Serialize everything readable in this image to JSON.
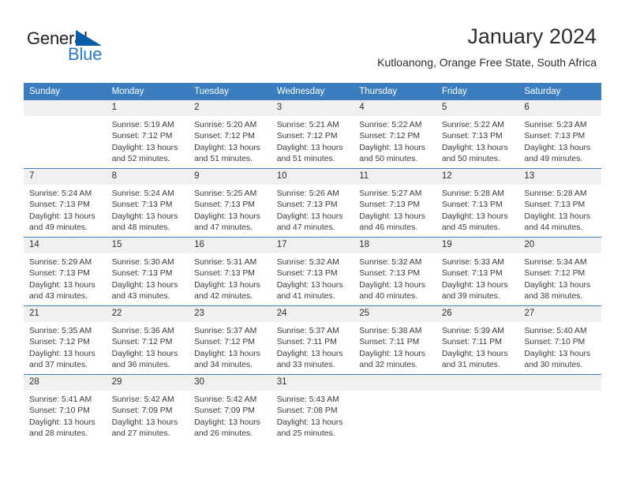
{
  "brand": {
    "name_part1": "General",
    "name_part2": "Blue",
    "accent_color": "#2b7cc4",
    "triangle_color": "#0a5ca8"
  },
  "header": {
    "title": "January 2024",
    "subtitle": "Kutloanong, Orange Free State, South Africa"
  },
  "calendar": {
    "header_bg": "#3b7dbf",
    "daynum_bg": "#f0f0f0",
    "weekday_headers": [
      "Sunday",
      "Monday",
      "Tuesday",
      "Wednesday",
      "Thursday",
      "Friday",
      "Saturday"
    ],
    "weeks": [
      [
        {
          "day": "",
          "blank": true,
          "sunrise": "",
          "sunset": "",
          "daylight_line1": "",
          "daylight_line2": ""
        },
        {
          "day": "1",
          "sunrise": "Sunrise: 5:19 AM",
          "sunset": "Sunset: 7:12 PM",
          "daylight_line1": "Daylight: 13 hours",
          "daylight_line2": "and 52 minutes."
        },
        {
          "day": "2",
          "sunrise": "Sunrise: 5:20 AM",
          "sunset": "Sunset: 7:12 PM",
          "daylight_line1": "Daylight: 13 hours",
          "daylight_line2": "and 51 minutes."
        },
        {
          "day": "3",
          "sunrise": "Sunrise: 5:21 AM",
          "sunset": "Sunset: 7:12 PM",
          "daylight_line1": "Daylight: 13 hours",
          "daylight_line2": "and 51 minutes."
        },
        {
          "day": "4",
          "sunrise": "Sunrise: 5:22 AM",
          "sunset": "Sunset: 7:12 PM",
          "daylight_line1": "Daylight: 13 hours",
          "daylight_line2": "and 50 minutes."
        },
        {
          "day": "5",
          "sunrise": "Sunrise: 5:22 AM",
          "sunset": "Sunset: 7:13 PM",
          "daylight_line1": "Daylight: 13 hours",
          "daylight_line2": "and 50 minutes."
        },
        {
          "day": "6",
          "sunrise": "Sunrise: 5:23 AM",
          "sunset": "Sunset: 7:13 PM",
          "daylight_line1": "Daylight: 13 hours",
          "daylight_line2": "and 49 minutes."
        }
      ],
      [
        {
          "day": "7",
          "sunrise": "Sunrise: 5:24 AM",
          "sunset": "Sunset: 7:13 PM",
          "daylight_line1": "Daylight: 13 hours",
          "daylight_line2": "and 49 minutes."
        },
        {
          "day": "8",
          "sunrise": "Sunrise: 5:24 AM",
          "sunset": "Sunset: 7:13 PM",
          "daylight_line1": "Daylight: 13 hours",
          "daylight_line2": "and 48 minutes."
        },
        {
          "day": "9",
          "sunrise": "Sunrise: 5:25 AM",
          "sunset": "Sunset: 7:13 PM",
          "daylight_line1": "Daylight: 13 hours",
          "daylight_line2": "and 47 minutes."
        },
        {
          "day": "10",
          "sunrise": "Sunrise: 5:26 AM",
          "sunset": "Sunset: 7:13 PM",
          "daylight_line1": "Daylight: 13 hours",
          "daylight_line2": "and 47 minutes."
        },
        {
          "day": "11",
          "sunrise": "Sunrise: 5:27 AM",
          "sunset": "Sunset: 7:13 PM",
          "daylight_line1": "Daylight: 13 hours",
          "daylight_line2": "and 46 minutes."
        },
        {
          "day": "12",
          "sunrise": "Sunrise: 5:28 AM",
          "sunset": "Sunset: 7:13 PM",
          "daylight_line1": "Daylight: 13 hours",
          "daylight_line2": "and 45 minutes."
        },
        {
          "day": "13",
          "sunrise": "Sunrise: 5:28 AM",
          "sunset": "Sunset: 7:13 PM",
          "daylight_line1": "Daylight: 13 hours",
          "daylight_line2": "and 44 minutes."
        }
      ],
      [
        {
          "day": "14",
          "sunrise": "Sunrise: 5:29 AM",
          "sunset": "Sunset: 7:13 PM",
          "daylight_line1": "Daylight: 13 hours",
          "daylight_line2": "and 43 minutes."
        },
        {
          "day": "15",
          "sunrise": "Sunrise: 5:30 AM",
          "sunset": "Sunset: 7:13 PM",
          "daylight_line1": "Daylight: 13 hours",
          "daylight_line2": "and 43 minutes."
        },
        {
          "day": "16",
          "sunrise": "Sunrise: 5:31 AM",
          "sunset": "Sunset: 7:13 PM",
          "daylight_line1": "Daylight: 13 hours",
          "daylight_line2": "and 42 minutes."
        },
        {
          "day": "17",
          "sunrise": "Sunrise: 5:32 AM",
          "sunset": "Sunset: 7:13 PM",
          "daylight_line1": "Daylight: 13 hours",
          "daylight_line2": "and 41 minutes."
        },
        {
          "day": "18",
          "sunrise": "Sunrise: 5:32 AM",
          "sunset": "Sunset: 7:13 PM",
          "daylight_line1": "Daylight: 13 hours",
          "daylight_line2": "and 40 minutes."
        },
        {
          "day": "19",
          "sunrise": "Sunrise: 5:33 AM",
          "sunset": "Sunset: 7:13 PM",
          "daylight_line1": "Daylight: 13 hours",
          "daylight_line2": "and 39 minutes."
        },
        {
          "day": "20",
          "sunrise": "Sunrise: 5:34 AM",
          "sunset": "Sunset: 7:12 PM",
          "daylight_line1": "Daylight: 13 hours",
          "daylight_line2": "and 38 minutes."
        }
      ],
      [
        {
          "day": "21",
          "sunrise": "Sunrise: 5:35 AM",
          "sunset": "Sunset: 7:12 PM",
          "daylight_line1": "Daylight: 13 hours",
          "daylight_line2": "and 37 minutes."
        },
        {
          "day": "22",
          "sunrise": "Sunrise: 5:36 AM",
          "sunset": "Sunset: 7:12 PM",
          "daylight_line1": "Daylight: 13 hours",
          "daylight_line2": "and 36 minutes."
        },
        {
          "day": "23",
          "sunrise": "Sunrise: 5:37 AM",
          "sunset": "Sunset: 7:12 PM",
          "daylight_line1": "Daylight: 13 hours",
          "daylight_line2": "and 34 minutes."
        },
        {
          "day": "24",
          "sunrise": "Sunrise: 5:37 AM",
          "sunset": "Sunset: 7:11 PM",
          "daylight_line1": "Daylight: 13 hours",
          "daylight_line2": "and 33 minutes."
        },
        {
          "day": "25",
          "sunrise": "Sunrise: 5:38 AM",
          "sunset": "Sunset: 7:11 PM",
          "daylight_line1": "Daylight: 13 hours",
          "daylight_line2": "and 32 minutes."
        },
        {
          "day": "26",
          "sunrise": "Sunrise: 5:39 AM",
          "sunset": "Sunset: 7:11 PM",
          "daylight_line1": "Daylight: 13 hours",
          "daylight_line2": "and 31 minutes."
        },
        {
          "day": "27",
          "sunrise": "Sunrise: 5:40 AM",
          "sunset": "Sunset: 7:10 PM",
          "daylight_line1": "Daylight: 13 hours",
          "daylight_line2": "and 30 minutes."
        }
      ],
      [
        {
          "day": "28",
          "sunrise": "Sunrise: 5:41 AM",
          "sunset": "Sunset: 7:10 PM",
          "daylight_line1": "Daylight: 13 hours",
          "daylight_line2": "and 28 minutes."
        },
        {
          "day": "29",
          "sunrise": "Sunrise: 5:42 AM",
          "sunset": "Sunset: 7:09 PM",
          "daylight_line1": "Daylight: 13 hours",
          "daylight_line2": "and 27 minutes."
        },
        {
          "day": "30",
          "sunrise": "Sunrise: 5:42 AM",
          "sunset": "Sunset: 7:09 PM",
          "daylight_line1": "Daylight: 13 hours",
          "daylight_line2": "and 26 minutes."
        },
        {
          "day": "31",
          "sunrise": "Sunrise: 5:43 AM",
          "sunset": "Sunset: 7:08 PM",
          "daylight_line1": "Daylight: 13 hours",
          "daylight_line2": "and 25 minutes."
        },
        {
          "day": "",
          "blank": true,
          "sunrise": "",
          "sunset": "",
          "daylight_line1": "",
          "daylight_line2": ""
        },
        {
          "day": "",
          "blank": true,
          "sunrise": "",
          "sunset": "",
          "daylight_line1": "",
          "daylight_line2": ""
        },
        {
          "day": "",
          "blank": true,
          "sunrise": "",
          "sunset": "",
          "daylight_line1": "",
          "daylight_line2": ""
        }
      ]
    ]
  }
}
